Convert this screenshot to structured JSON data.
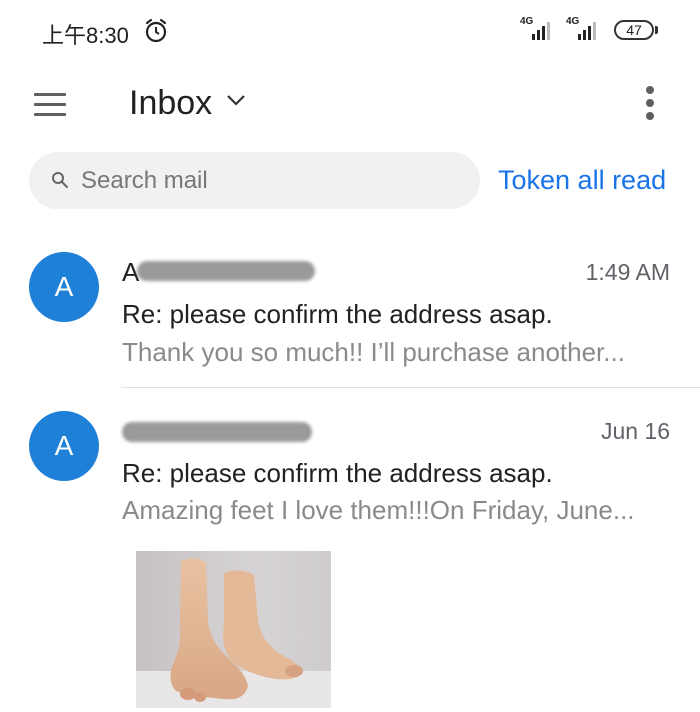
{
  "status_bar": {
    "time": "上午8:30",
    "signal_1": "4G",
    "signal_2": "4G",
    "battery": "47"
  },
  "app_bar": {
    "folder": "Inbox"
  },
  "search": {
    "placeholder": "Search mail"
  },
  "actions": {
    "mark_read": "Token all read"
  },
  "messages": [
    {
      "avatar": "A",
      "sender_visible": "A",
      "time": "1:49 AM",
      "subject": "Re: please confirm the address asap.",
      "snippet": "Thank you so much!! I’ll purchase another..."
    },
    {
      "avatar": "A",
      "sender_visible": "",
      "time": "Jun 16",
      "subject": "Re: please confirm the address asap.",
      "snippet": "Amazing feet I love them!!!On Friday, June..."
    }
  ],
  "colors": {
    "accent": "#1a73e8",
    "avatar": "#1e80d6"
  }
}
